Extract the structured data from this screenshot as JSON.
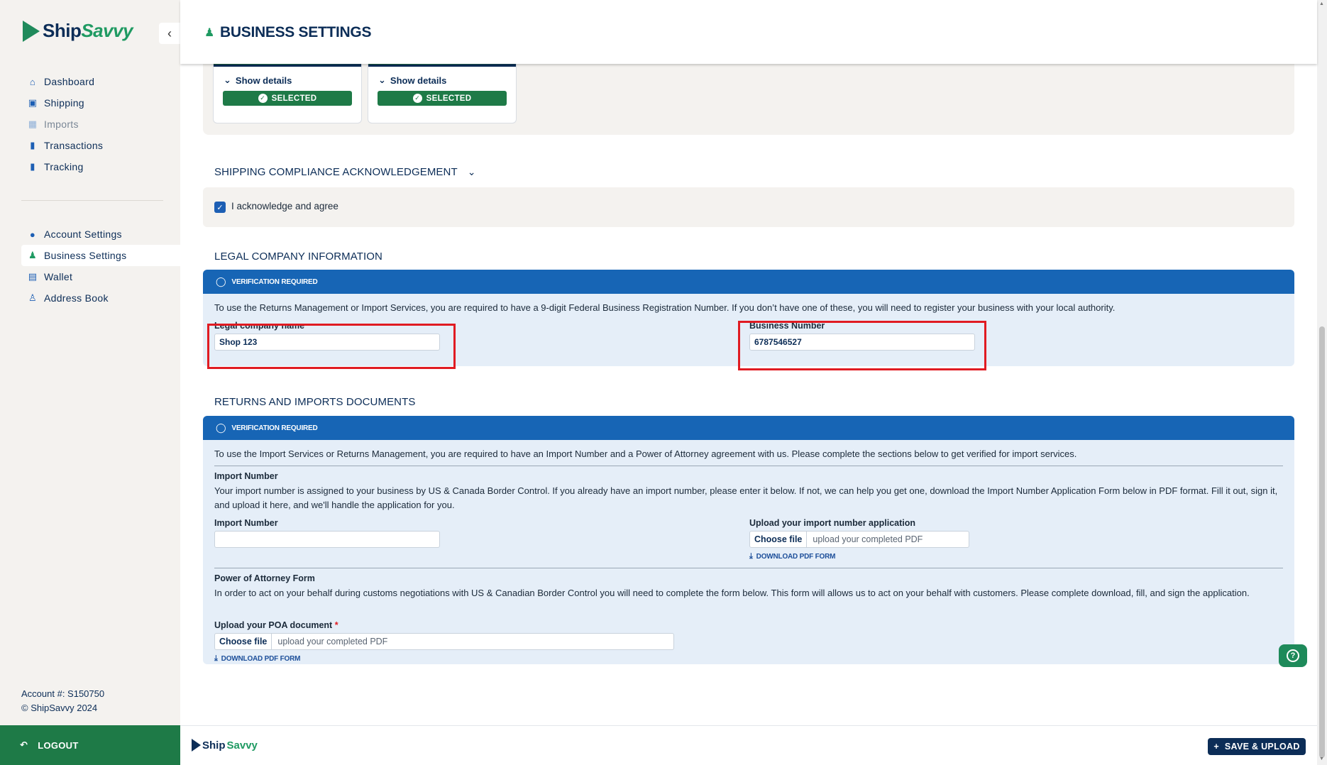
{
  "app": {
    "brand_ship": "Ship",
    "brand_savvy": "Savvy"
  },
  "header": {
    "title": "BUSINESS SETTINGS"
  },
  "sidebar": {
    "main_items": [
      {
        "label": "Dashboard",
        "icon": "home-icon"
      },
      {
        "label": "Shipping",
        "icon": "box-icon"
      },
      {
        "label": "Imports",
        "icon": "import-icon",
        "disabled": true
      },
      {
        "label": "Transactions",
        "icon": "document-icon"
      },
      {
        "label": "Tracking",
        "icon": "document-icon"
      }
    ],
    "settings_items": [
      {
        "label": "Account Settings",
        "icon": "user-icon"
      },
      {
        "label": "Business Settings",
        "icon": "business-users-icon",
        "active": true
      },
      {
        "label": "Wallet",
        "icon": "wallet-icon"
      },
      {
        "label": "Address Book",
        "icon": "address-book-icon"
      }
    ],
    "account_line": "Account #: S150750",
    "copyright": "© ShipSavvy 2024",
    "logout": "LOGOUT"
  },
  "cards": [
    {
      "show_details": "Show details",
      "status": "SELECTED"
    },
    {
      "show_details": "Show details",
      "status": "SELECTED"
    }
  ],
  "compliance": {
    "title": "SHIPPING COMPLIANCE ACKNOWLEDGEMENT",
    "checkbox_label": "I acknowledge and agree",
    "checked": true
  },
  "legal": {
    "title": "LEGAL COMPANY INFORMATION",
    "verification": "VERIFICATION REQUIRED",
    "description": "To use the Returns Management or Import Services, you are required to have a 9-digit Federal Business Registration Number. If you don’t have one of these, you will need to register your business with your local authority.",
    "company_name_label": "Legal company name",
    "company_name_value": "Shop 123",
    "business_number_label": "Business Number",
    "business_number_value": "6787546527"
  },
  "returns": {
    "title": "RETURNS AND IMPORTS DOCUMENTS",
    "verification": "VERIFICATION REQUIRED",
    "description": "To use the Import Services or Returns Management, you are required to have an Import Number and a Power of Attorney agreement with us. Please complete the sections below to get verified for import services.",
    "import_title": "Import Number",
    "import_desc": "Your import number is assigned to your business by US & Canada Border Control. If you already have an import number, please enter it below. If not, we can help you get one, download the Import Number Application Form below in PDF format. Fill it out, sign it, and upload it here, and we'll handle the application for you.",
    "import_number_label": "Import Number",
    "import_number_value": "",
    "upload_app_label": "Upload your import number application",
    "choose_file": "Choose file",
    "upload_placeholder": "upload your completed PDF",
    "download_label": "DOWNLOAD PDF FORM",
    "poa_title": "Power of Attorney Form",
    "poa_desc": "In order to act on your behalf during customs negotiations with US & Canadian Border Control you will need to complete the form below. This form will allows us to act on your behalf with customers. Please complete download, fill, and sign the application.",
    "poa_upload_label": "Upload your POA document",
    "required_mark": "*"
  },
  "footer": {
    "brand_ship": "Ship",
    "brand_savvy": "Savvy",
    "save_label": "SAVE & UPLOAD"
  },
  "colors": {
    "brand_green": "#1e7a47",
    "brand_navy": "#0c2d57",
    "verify_blue": "#1765b5",
    "highlight_red": "#e01b22"
  }
}
